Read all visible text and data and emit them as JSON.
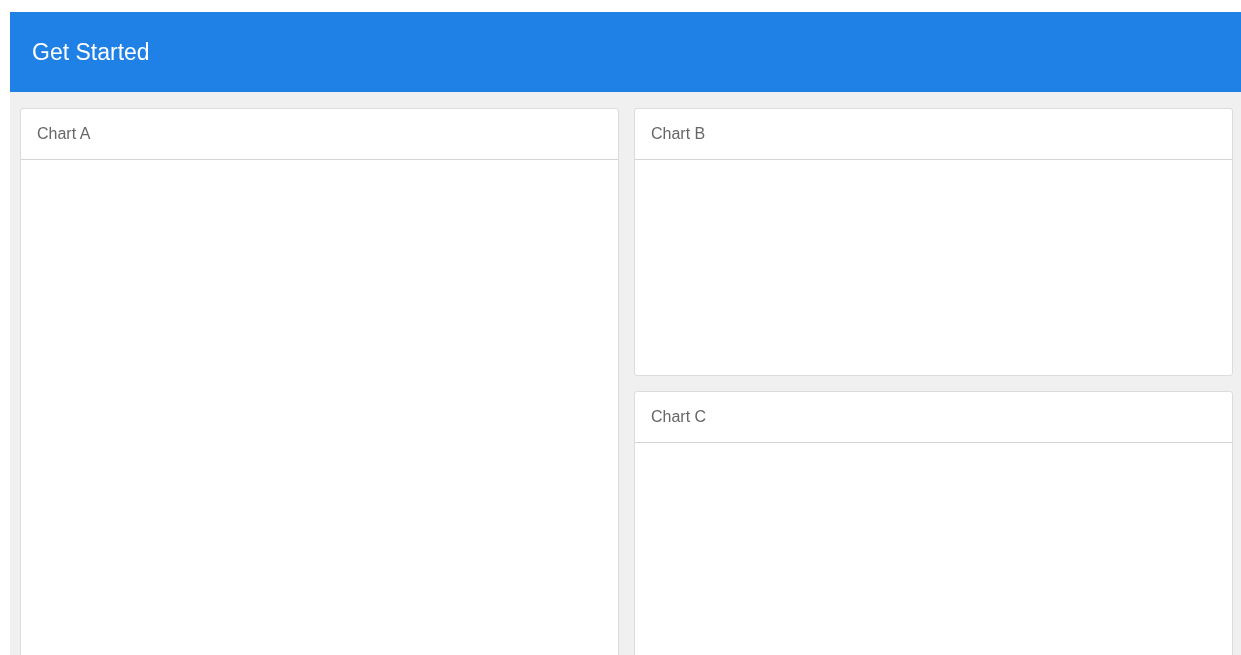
{
  "header": {
    "title": "Get Started"
  },
  "columns": [
    {
      "cards": [
        {
          "title": "Chart A",
          "kind": "tall"
        }
      ]
    },
    {
      "cards": [
        {
          "title": "Chart B",
          "kind": "short"
        },
        {
          "title": "Chart C",
          "kind": "tall"
        }
      ]
    }
  ]
}
